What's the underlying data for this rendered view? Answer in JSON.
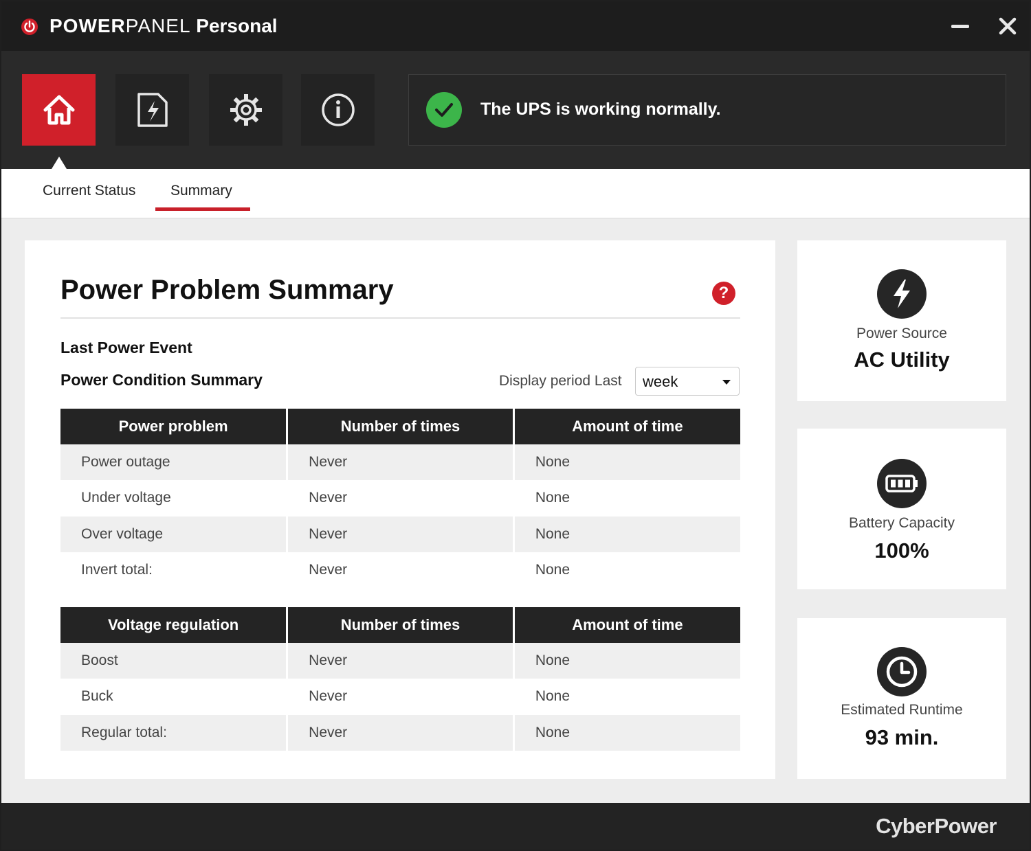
{
  "app": {
    "title_bold": "POWER",
    "title_light": "PANEL",
    "title_suffix": "Personal"
  },
  "window_controls": {
    "minimize": "minimize-icon",
    "close": "close-icon"
  },
  "nav": {
    "items": [
      {
        "icon": "home-icon",
        "active": true
      },
      {
        "icon": "power-log-icon",
        "active": false
      },
      {
        "icon": "gear-icon",
        "active": false
      },
      {
        "icon": "info-icon",
        "active": false
      }
    ]
  },
  "status": {
    "message": "The UPS is working normally.",
    "icon": "check-icon",
    "color": "#3cb54a"
  },
  "tabs": [
    {
      "label": "Current Status"
    },
    {
      "label": "Summary",
      "selected": true
    }
  ],
  "summary": {
    "title": "Power Problem Summary",
    "help_icon": "?",
    "last_event_label": "Last Power Event",
    "condition_label": "Power Condition Summary",
    "display_period_label": "Display period Last",
    "display_period_value": "week",
    "problem_table": {
      "headers": [
        "Power problem",
        "Number of times",
        "Amount of time"
      ],
      "rows": [
        [
          "Power outage",
          "Never",
          "None"
        ],
        [
          "Under voltage",
          "Never",
          "None"
        ],
        [
          "Over voltage",
          "Never",
          "None"
        ],
        [
          "Invert total:",
          "Never",
          "None"
        ]
      ]
    },
    "voltage_table": {
      "headers": [
        "Voltage regulation",
        "Number of times",
        "Amount of time"
      ],
      "rows": [
        [
          "Boost",
          "Never",
          "None"
        ],
        [
          "Buck",
          "Never",
          "None"
        ],
        [
          "Regular total:",
          "Never",
          "None"
        ]
      ]
    }
  },
  "side": {
    "power_source": {
      "label": "Power Source",
      "value": "AC Utility",
      "icon": "lightning-icon"
    },
    "battery": {
      "label": "Battery Capacity",
      "value": "100%",
      "icon": "battery-icon"
    },
    "runtime": {
      "label": "Estimated Runtime",
      "value": "93 min.",
      "icon": "clock-icon"
    }
  },
  "footer": {
    "brand": "CyberPower"
  },
  "colors": {
    "accent": "#d0202a",
    "dark": "#1d1d1d",
    "ok": "#3cb54a"
  }
}
